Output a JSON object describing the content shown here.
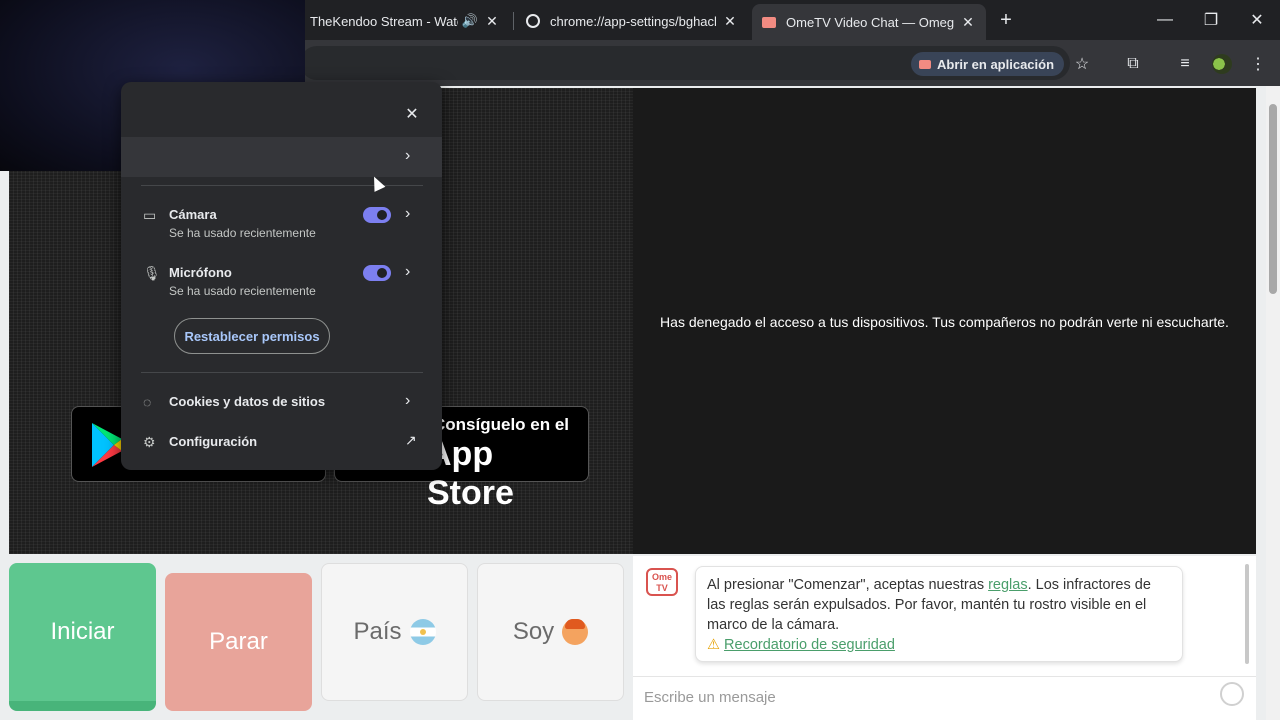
{
  "browser": {
    "tabs": [
      {
        "title": "TheKendoo Stream - Watch"
      },
      {
        "title": "chrome://app-settings/bghachc"
      },
      {
        "title": "OmeTV Video Chat — Omegle"
      }
    ],
    "new_tab": "+",
    "close_glyph": "✕",
    "open_in_app_label": "Abrir en aplicación",
    "window_controls": {
      "minimize": "—",
      "restore": "❐",
      "close": "✕"
    }
  },
  "popup": {
    "close": "✕",
    "permissions": [
      {
        "label": "Cámara",
        "status": "Se ha usado recientemente",
        "enabled": true,
        "icon": "camera-icon"
      },
      {
        "label": "Micrófono",
        "status": "Se ha usado recientemente",
        "enabled": true,
        "icon": "microphone-icon"
      }
    ],
    "reset_button": "Restablecer permisos",
    "cookies_label": "Cookies y datos de sitios",
    "settings_label": "Configuración",
    "chevron": "›"
  },
  "page": {
    "denied_message": "Has denegado el acceso a tus dispositivos. Tus compañeros no podrán verte ni escucharte.",
    "appstore_badge": {
      "small": "Consíguelo en el",
      "big": "App Store"
    },
    "buttons": {
      "start": "Iniciar",
      "stop": "Parar",
      "country": "País",
      "gender": "Soy"
    },
    "chat": {
      "logo": "Ome TV",
      "message_before": "Al presionar \"Comenzar\", aceptas nuestras ",
      "rules_link": "reglas",
      "message_after": ". Los infractores de las reglas serán expulsados. Por favor, mantén tu rostro visible en el marco de la cámara.",
      "warning_icon": "⚠",
      "safety_link": "Recordatorio de seguridad",
      "input_placeholder": "Escribe un mensaje"
    }
  },
  "colors": {
    "start_button": "#5ec78f",
    "stop_button": "#e8a49a",
    "link_green": "#4a9e6b",
    "toggle_on": "#7c7ff0"
  }
}
